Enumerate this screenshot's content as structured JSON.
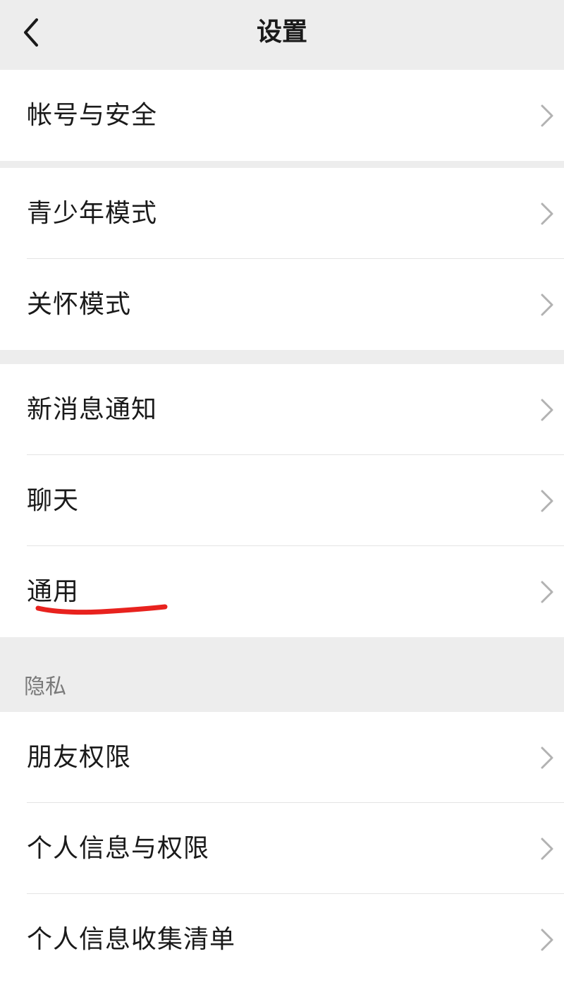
{
  "header": {
    "title": "设置",
    "back_icon": "chevron-left-icon"
  },
  "groups": [
    {
      "items": [
        {
          "label": "帐号与安全"
        }
      ]
    },
    {
      "items": [
        {
          "label": "青少年模式"
        },
        {
          "label": "关怀模式"
        }
      ]
    },
    {
      "items": [
        {
          "label": "新消息通知"
        },
        {
          "label": "聊天"
        },
        {
          "label": "通用"
        }
      ]
    },
    {
      "title": "隐私",
      "items": [
        {
          "label": "朋友权限"
        },
        {
          "label": "个人信息与权限"
        },
        {
          "label": "个人信息收集清单"
        }
      ]
    }
  ],
  "colors": {
    "page_bg": "#ededed",
    "row_bg": "#ffffff",
    "chevron": "#b2b2b2",
    "annotation": "#e8221e"
  }
}
